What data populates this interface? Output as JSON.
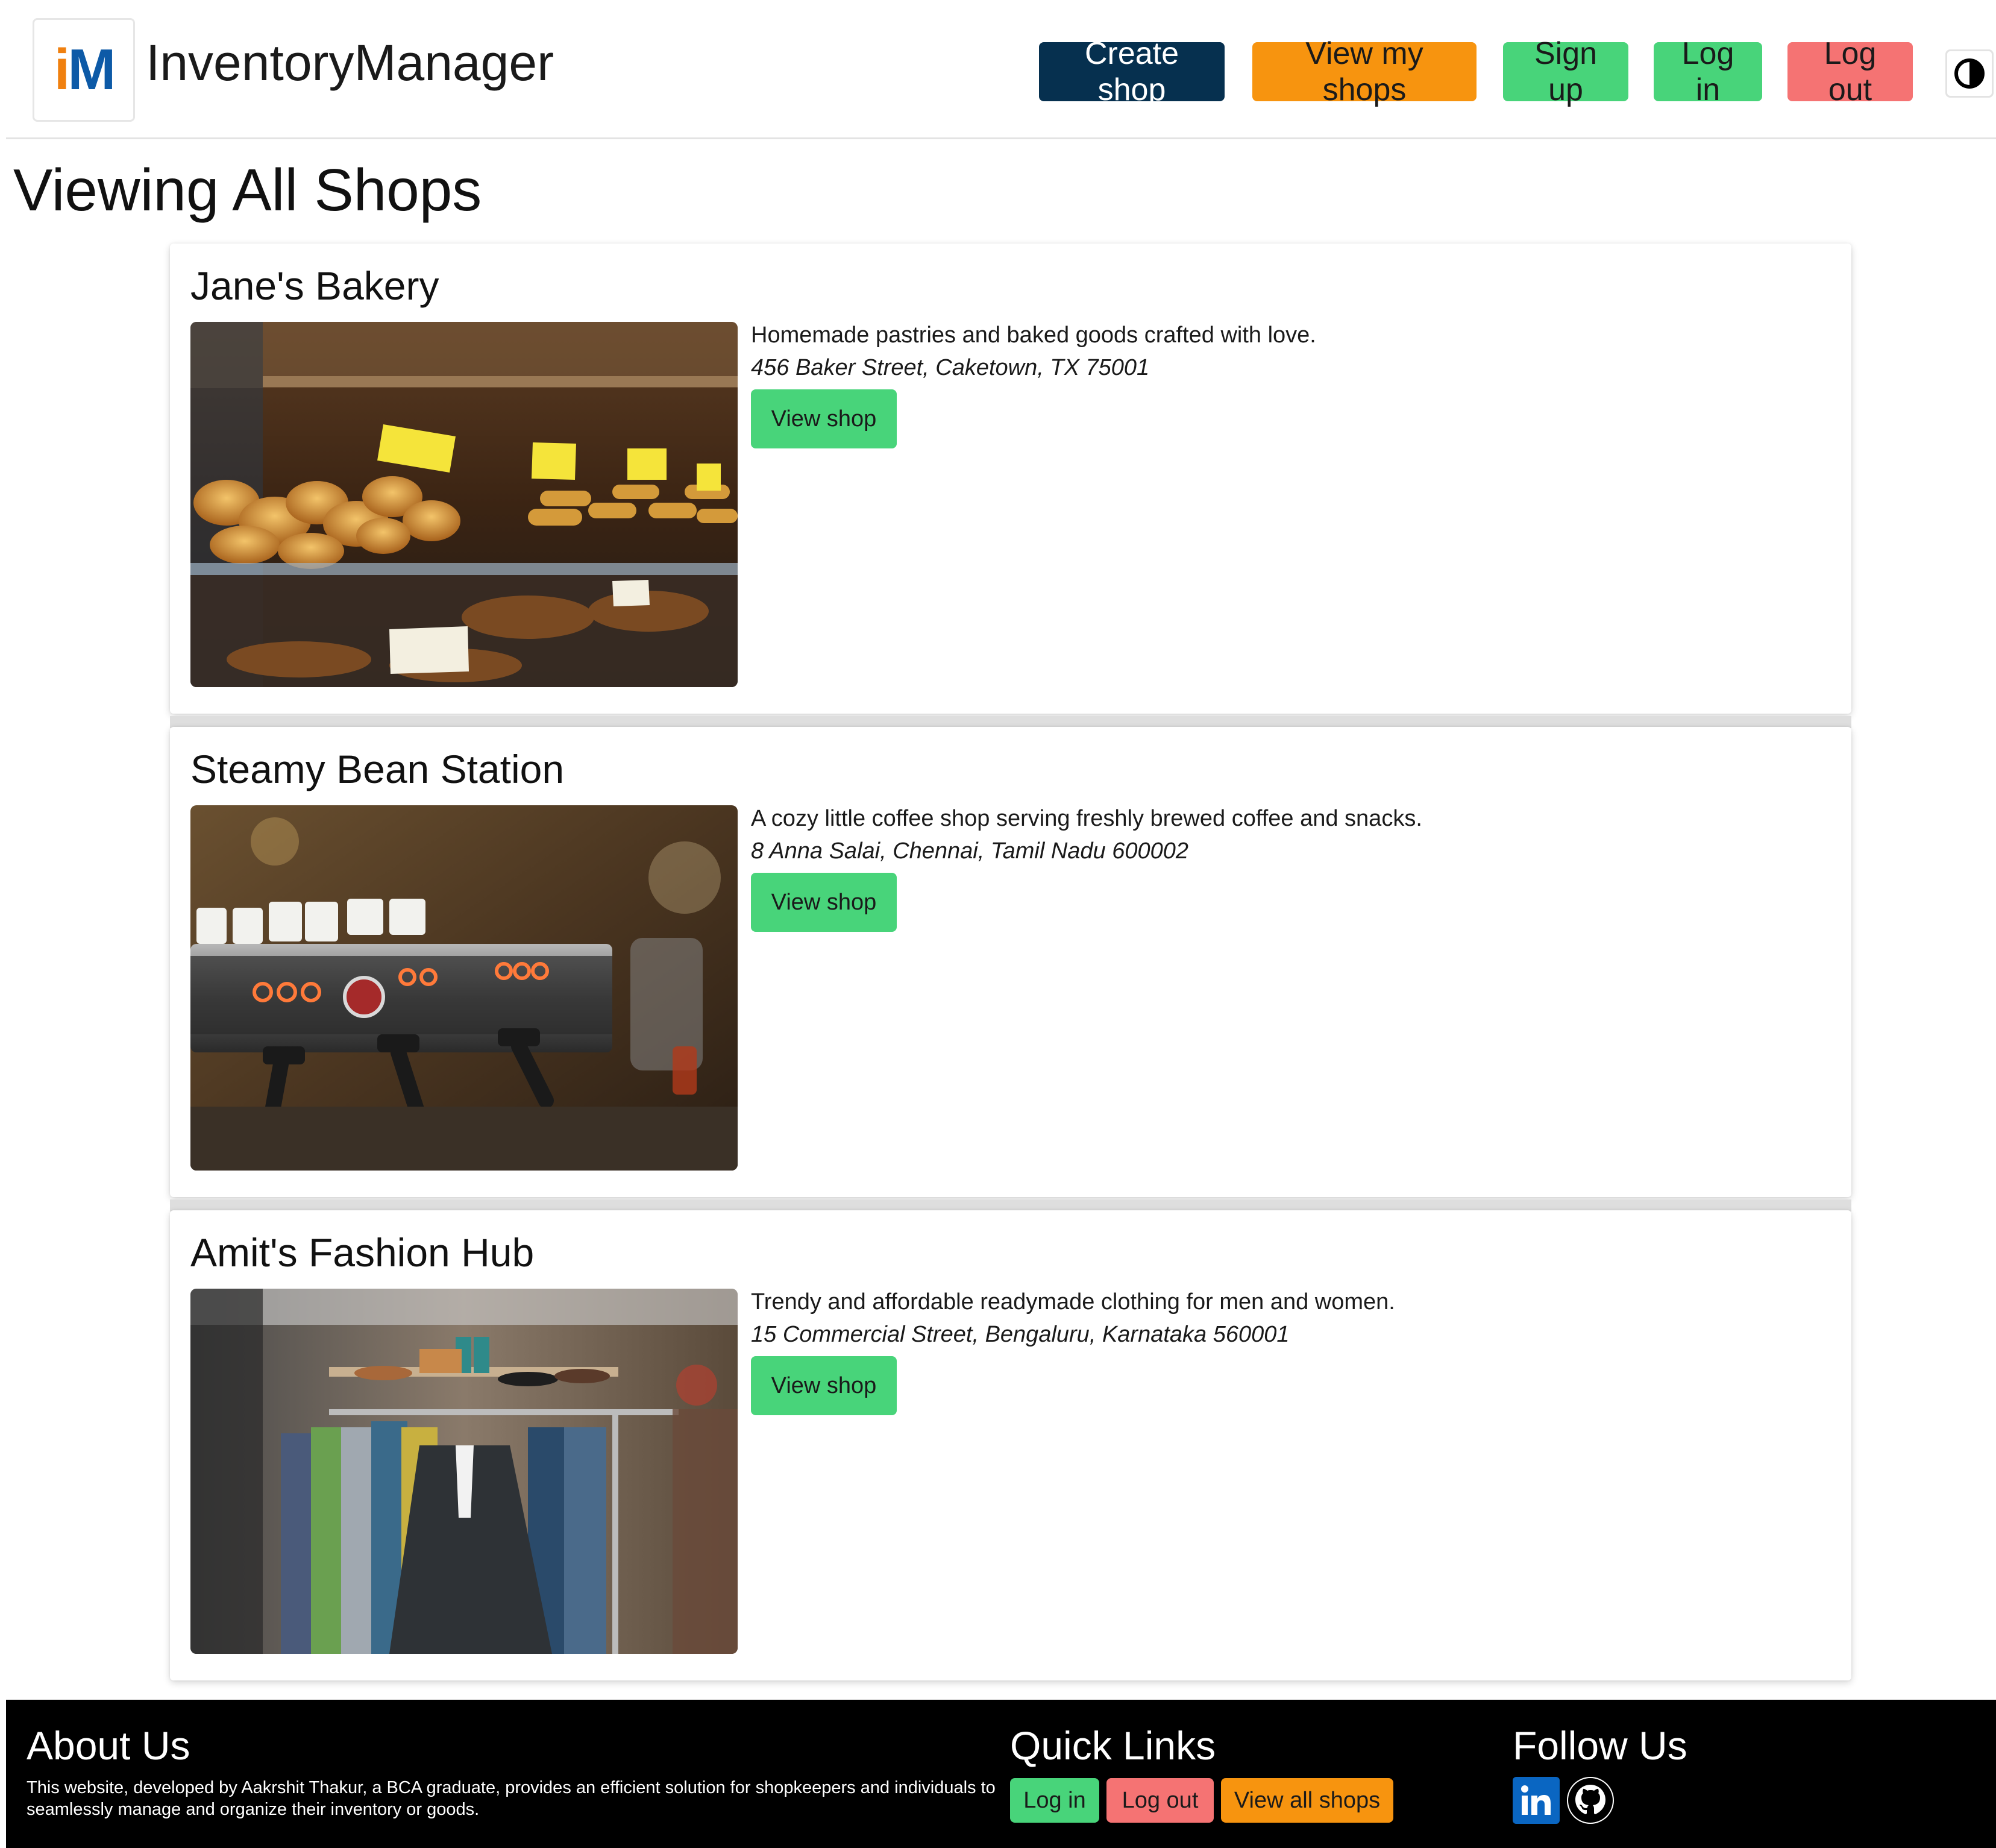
{
  "header": {
    "logo_text_i": "i",
    "logo_text_m": "M",
    "brand": "InventoryManager",
    "nav": {
      "create_shop": "Create shop",
      "view_my_shops": "View my shops",
      "sign_up": "Sign up",
      "log_in": "Log in",
      "log_out": "Log out"
    },
    "theme_toggle_icon": "contrast-icon"
  },
  "page_title": "Viewing All Shops",
  "shops": [
    {
      "name": "Jane's Bakery",
      "description": "Homemade pastries and baked goods crafted with love.",
      "address": "456 Baker Street, Caketown, TX 75001",
      "button": "View shop",
      "image": "bakery-display-photo"
    },
    {
      "name": "Steamy Bean Station",
      "description": "A cozy little coffee shop serving freshly brewed coffee and snacks.",
      "address": "8 Anna Salai, Chennai, Tamil Nadu 600002",
      "button": "View shop",
      "image": "espresso-machine-photo"
    },
    {
      "name": "Amit's Fashion Hub",
      "description": "Trendy and affordable readymade clothing for men and women.",
      "address": "15 Commercial Street, Bengaluru, Karnataka 560001",
      "button": "View shop",
      "image": "clothing-rack-photo"
    }
  ],
  "footer": {
    "about": {
      "heading": "About Us",
      "text": "This website, developed by Aakrshit Thakur, a BCA graduate, provides an efficient solution for shopkeepers and individuals to seamlessly manage and organize their inventory or goods."
    },
    "quick_links": {
      "heading": "Quick Links",
      "log_in": "Log in",
      "log_out": "Log out",
      "view_all_shops": "View all shops"
    },
    "follow_us": {
      "heading": "Follow Us",
      "icons": [
        "linkedin-icon",
        "github-icon"
      ]
    }
  },
  "colors": {
    "navy": "#06304f",
    "orange": "#f7940f",
    "green": "#48d47a",
    "red": "#f57373",
    "logo_orange": "#f0800f",
    "logo_blue": "#0d5aa7"
  }
}
